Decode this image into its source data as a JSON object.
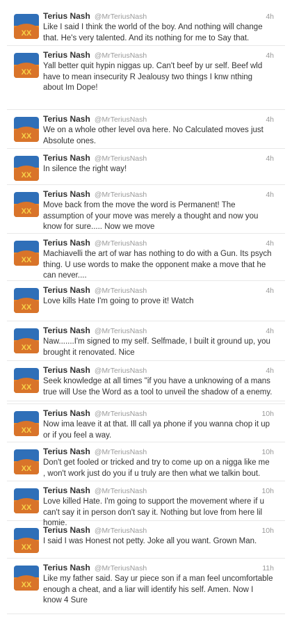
{
  "colors": {
    "avatar_sky": "#2f6fb8",
    "avatar_fill": "#e6862b",
    "avatar_text": "#f7d24a"
  },
  "avatar_icon": "orange-ovo-logo-avatar",
  "tweets": [
    {
      "name": "Terius Nash",
      "handle": "@MrTeriusNash",
      "time": "4h",
      "text": "Like I said I think the world of the boy. And nothing will change that. He's very talented. And its nothing for me to Say that."
    },
    {
      "name": "Terius Nash",
      "handle": "@MrTeriusNash",
      "time": "4h",
      "text": "Yall better quit hypin niggas up. Can't beef by ur self. Beef wld have to mean insecurity R Jealousy two things I knw nthing about Im Dope!"
    },
    {
      "name": "Terius Nash",
      "handle": "@MrTeriusNash",
      "time": "4h",
      "text": "We on a whole other level ova here. No Calculated moves just Absolute ones."
    },
    {
      "name": "Terius Nash",
      "handle": "@MrTeriusNash",
      "time": "4h",
      "text": "In silence the right way!"
    },
    {
      "name": "Terius Nash",
      "handle": "@MrTeriusNash",
      "time": "4h",
      "text": "Move back from the move the word is Permanent! The assumption of your move was merely a thought and now you know for sure..... Now we move"
    },
    {
      "name": "Terius Nash",
      "handle": "@MrTeriusNash",
      "time": "4h",
      "text": "Machiavelli the art of war has nothing to do with a Gun. Its psych thing. U use words to make the opponent make a move that he can never...."
    },
    {
      "name": "Terius Nash",
      "handle": "@MrTeriusNash",
      "time": "4h",
      "text": "Love kills Hate I'm going to prove it! Watch"
    },
    {
      "name": "Terius Nash",
      "handle": "@MrTeriusNash",
      "time": "4h",
      "text": "Naw.......I'm signed to my self. Selfmade, I built it ground up, you brought it renovated. Nice"
    },
    {
      "name": "Terius Nash",
      "handle": "@MrTeriusNash",
      "time": "4h",
      "text": "Seek knowledge at all times \"if you have a unknowing of a mans true will Use the Word as a tool to unveil the shadow of a enemy."
    },
    {
      "name": "Terius Nash",
      "handle": "@MrTeriusNash",
      "time": "10h",
      "text": "Now ima leave it at that. Ill call ya phone if you wanna chop it up or if you feel a way."
    },
    {
      "name": "Terius Nash",
      "handle": "@MrTeriusNash",
      "time": "10h",
      "text": "Don't get fooled or tricked and try to come up on a nigga like me , won't work just do you if u truly are then what we talkin bout."
    },
    {
      "name": "Terius Nash",
      "handle": "@MrTeriusNash",
      "time": "10h",
      "text": "Love killed Hate. I'm going to support the movement where if u can't say it in person don't say it. Nothing but love from here lil homie."
    },
    {
      "name": "Terius Nash",
      "handle": "@MrTeriusNash",
      "time": "10h",
      "text": "I said I was Honest not petty. Joke all you want. Grown Man."
    },
    {
      "name": "Terius Nash",
      "handle": "@MrTeriusNash",
      "time": "11h",
      "text": "Like my father said. Say ur piece son if a man feel uncomfortable enough a cheat, and a liar will identify his self. Amen. Now I know 4 Sure"
    }
  ]
}
